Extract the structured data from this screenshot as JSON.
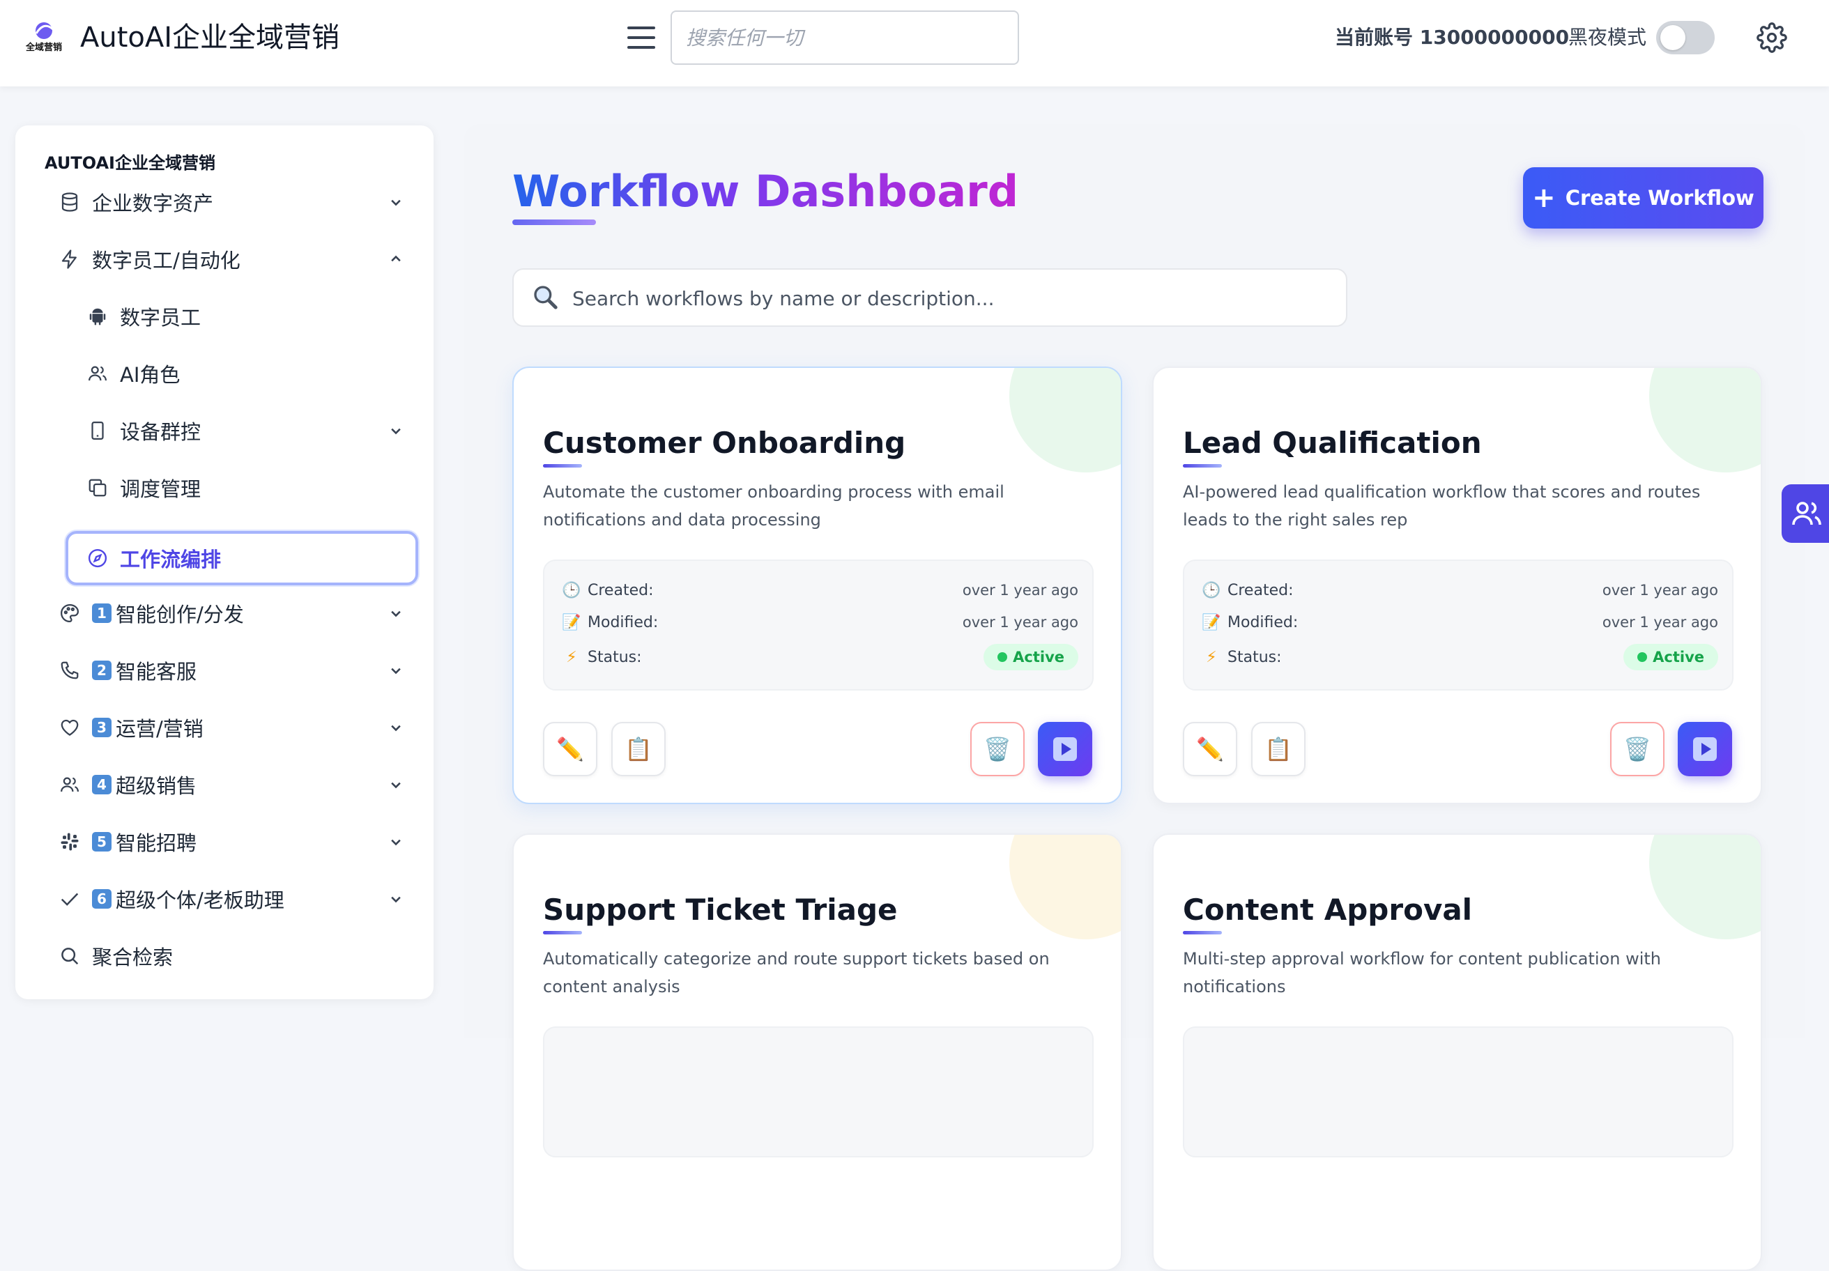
{
  "header": {
    "app_title": "AutoAI企业全域营销",
    "logo_text": "全域营销",
    "search_placeholder": "搜索任何一切",
    "account_label": "当前账号 13000000000",
    "dark_mode_label": "黑夜模式",
    "dark_mode_on": false
  },
  "sidebar": {
    "title": "AUTOAI企业全域营销",
    "items": [
      {
        "label": "企业数字资产",
        "icon": "database-icon",
        "expandable": true,
        "expanded": false
      },
      {
        "label": "数字员工/自动化",
        "icon": "bolt-icon",
        "expandable": true,
        "expanded": true
      },
      {
        "label": "数字员工",
        "icon": "android-icon",
        "sub": true
      },
      {
        "label": "AI角色",
        "icon": "users-icon",
        "sub": true
      },
      {
        "label": "设备群控",
        "icon": "phone-icon",
        "sub": true,
        "expandable": true
      },
      {
        "label": "调度管理",
        "icon": "copy-icon",
        "sub": true
      },
      {
        "label": "工作流编排",
        "icon": "compass-icon",
        "sub": true,
        "active": true
      },
      {
        "label": "智能创作/分发",
        "badge": "1",
        "icon": "palette-icon",
        "expandable": true
      },
      {
        "label": "智能客服",
        "badge": "2",
        "icon": "phone-call-icon",
        "expandable": true
      },
      {
        "label": "运营/营销",
        "badge": "3",
        "icon": "heart-icon",
        "expandable": true
      },
      {
        "label": "超级销售",
        "badge": "4",
        "icon": "users-icon",
        "expandable": true
      },
      {
        "label": "智能招聘",
        "badge": "5",
        "icon": "slack-icon",
        "expandable": true
      },
      {
        "label": "超级个体/老板助理",
        "badge": "6",
        "icon": "check-icon",
        "expandable": true
      },
      {
        "label": "聚合检索",
        "icon": "search-icon"
      }
    ]
  },
  "main": {
    "title": "Workflow Dashboard",
    "create_button": "Create Workflow",
    "search_placeholder": "Search workflows by name or description...",
    "meta_labels": {
      "created": "Created:",
      "modified": "Modified:",
      "status": "Status:"
    },
    "workflows": [
      {
        "name": "Customer Onboarding",
        "description": "Automate the customer onboarding process with email notifications and data processing",
        "created": "over 1 year ago",
        "modified": "over 1 year ago",
        "status": "Active",
        "accent": "#dcfce7"
      },
      {
        "name": "Lead Qualification",
        "description": "AI-powered lead qualification workflow that scores and routes leads to the right sales rep",
        "created": "over 1 year ago",
        "modified": "over 1 year ago",
        "status": "Active",
        "accent": "#dcfce7"
      },
      {
        "name": "Support Ticket Triage",
        "description": "Automatically categorize and route support tickets based on content analysis",
        "accent": "#fef3c7"
      },
      {
        "name": "Content Approval",
        "description": "Multi-step approval workflow for content publication with notifications",
        "accent": "#dcfce7"
      }
    ]
  },
  "colors": {
    "primary": "#4f46e5",
    "active_green": "#16a34a",
    "badge_blue": "#4b8bd6"
  }
}
